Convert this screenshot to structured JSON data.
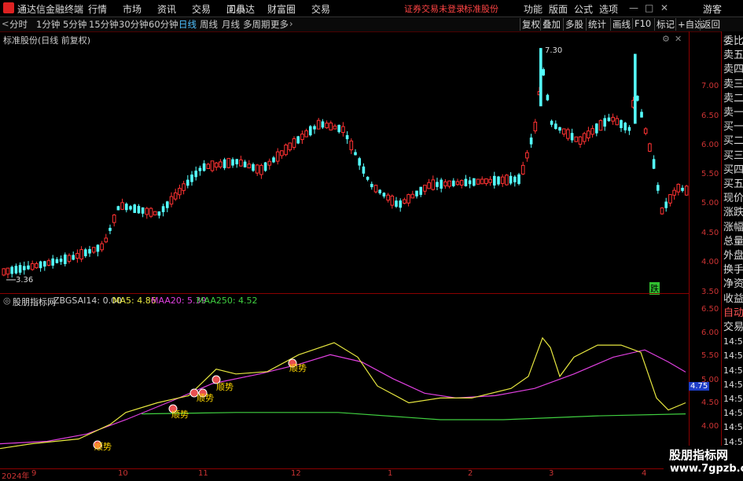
{
  "app": {
    "title": "通达信金融终端"
  },
  "menu": [
    "行情",
    "市场",
    "资讯",
    "交易",
    "工具",
    "问小达",
    "财富圈",
    "交易"
  ],
  "alert": {
    "text": "证券交易未登录",
    "stock": "标准股份"
  },
  "toolbar_right": [
    "功能",
    "版面",
    "公式",
    "选项"
  ],
  "user": "游客",
  "periods": [
    "分时",
    "1分钟",
    "5分钟",
    "15分钟",
    "30分钟",
    "60分钟",
    "日线",
    "周线",
    "月线",
    "多周期",
    "更多"
  ],
  "active_period": "日线",
  "chart_buttons": [
    "复权",
    "叠加",
    "多股",
    "统计",
    "画线",
    "F10",
    "标记",
    "+自选",
    "返回"
  ],
  "price_pane": {
    "header": "标准股份(日线 前复权)",
    "high_label": "7.30",
    "low_label": "3.36",
    "signal": "跌"
  },
  "indicator": {
    "name": "股朋指标网",
    "items": [
      {
        "text": "ZBGSAI14: 0.00",
        "color": "#cccccc"
      },
      {
        "text": "MA5: 4.86",
        "color": "#e8e840"
      },
      {
        "text": "MAA20: 5.39",
        "color": "#e040e0"
      },
      {
        "text": "MAA250: 4.52",
        "color": "#40d040"
      }
    ],
    "current_value": "4.75",
    "signal_label": "顺势"
  },
  "price_ticks": [
    "7.00",
    "6.50",
    "6.00",
    "5.50",
    "5.00",
    "4.50",
    "4.00",
    "3.50"
  ],
  "ind_ticks": [
    "6.50",
    "6.00",
    "5.50",
    "5.00",
    "4.50",
    "4.00"
  ],
  "dates": [
    "2024年",
    "9",
    "10",
    "11",
    "12",
    "1",
    "2",
    "3",
    "4"
  ],
  "right_panel": [
    "委比",
    "卖五",
    "卖四",
    "卖三",
    "卖二",
    "卖一",
    "买一",
    "买二",
    "买三",
    "买四",
    "买五",
    "现价",
    "涨跌",
    "涨幅",
    "总量",
    "外盘",
    "换手",
    "净资",
    "收益",
    "自动",
    "交易",
    "14:56",
    "14:56",
    "14:56",
    "14:56",
    "14:56",
    "14:56",
    "14:56",
    "14:56",
    "14:56"
  ],
  "watermark": {
    "line1": "股朋指标网",
    "line2": "www.7gpzb.com"
  },
  "colors": {
    "up": "#ff3232",
    "down": "#54ffff",
    "ma5": "#e8e840",
    "maa20": "#e040e0",
    "maa250": "#40d040",
    "frame": "#8b0000"
  },
  "chart_data": {
    "type": "candlestick",
    "title": "标准股份(日线 前复权)",
    "ylim": [
      3.2,
      7.45
    ],
    "x": [
      "2024-08",
      "2024-09",
      "2024-10",
      "2024-11",
      "2024-12",
      "2025-01",
      "2025-02",
      "2025-03",
      "2025-04"
    ],
    "close": [
      3.45,
      3.6,
      4.5,
      5.1,
      5.9,
      4.6,
      4.9,
      6.1,
      4.8
    ],
    "indicator_series": {
      "ma5": [
        4.0,
        4.35,
        5.3,
        5.65,
        4.8,
        5.0,
        6.0,
        4.75
      ],
      "maa20": [
        3.9,
        4.2,
        4.9,
        5.4,
        5.6,
        5.2,
        5.8,
        5.39
      ],
      "maa250": [
        4.52,
        4.52,
        4.52,
        4.52,
        4.52,
        4.52,
        4.52,
        4.52
      ]
    },
    "ind_ylim": [
      3.55,
      6.85
    ]
  }
}
